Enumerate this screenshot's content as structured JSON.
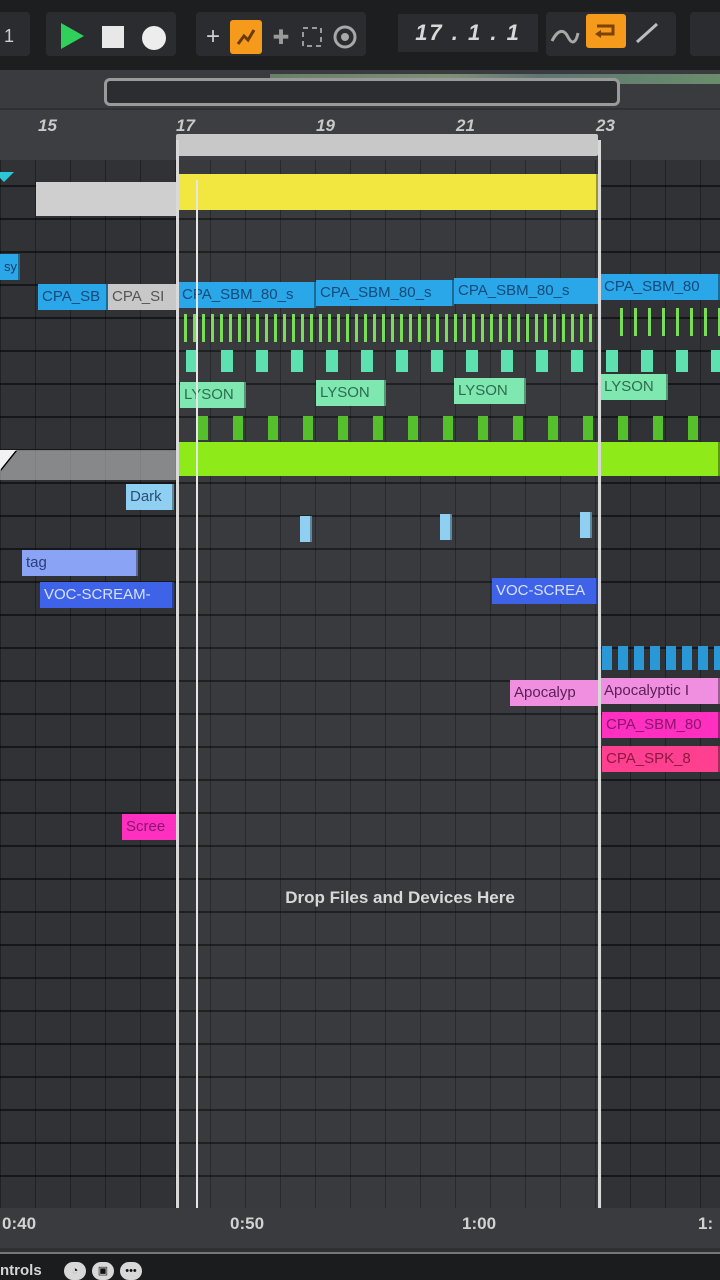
{
  "transport": {
    "play_icon": "play-icon",
    "stop_icon": "stop-icon",
    "record_icon": "record-icon",
    "position": "17 .  1 .  1",
    "accent": "#f59a1b"
  },
  "ruler": {
    "bars": [
      "15",
      "17",
      "19",
      "21",
      "23"
    ]
  },
  "clips": {
    "cpa_1": "CPA_SB",
    "cpa_2": "CPA_SI",
    "cpa_3": "CPA_SBM_80_s",
    "cpa_4": "CPA_SBM_80_s",
    "cpa_5": "CPA_SBM_80_s",
    "cpa_6": "CPA_SBM_80",
    "sy": "sy",
    "lyson_1": "LYSON",
    "lyson_2": "LYSON",
    "lyson_3": "LYSON",
    "lyson_4": "LYSON",
    "dark": "Dark",
    "tag": "tag",
    "voc_1": "VOC-SCREAM-",
    "voc_2": "VOC-SCREA",
    "apoc_1": "Apocalyp",
    "apoc_2": "Apocalyptic I",
    "cpa_pink_1": "CPA_SBM_80",
    "cpa_pink_2": "CPA_SPK_8",
    "screen": "Scree"
  },
  "drop_hint": "Drop Files and Devices Here",
  "time_ruler": {
    "t1": "0:40",
    "t2": "0:50",
    "t3": "1:00",
    "t4": "1:"
  },
  "footer": {
    "controls_label": "ntrols"
  },
  "colors": {
    "yellow": "#f2e640",
    "lime": "#8fea1a",
    "blue": "#29a7e8",
    "mint": "#7fe8b0",
    "magenta": "#ff2fbf",
    "pink": "#f08fe0",
    "hotpink": "#ff3f8f",
    "navy": "#3f63e8"
  }
}
